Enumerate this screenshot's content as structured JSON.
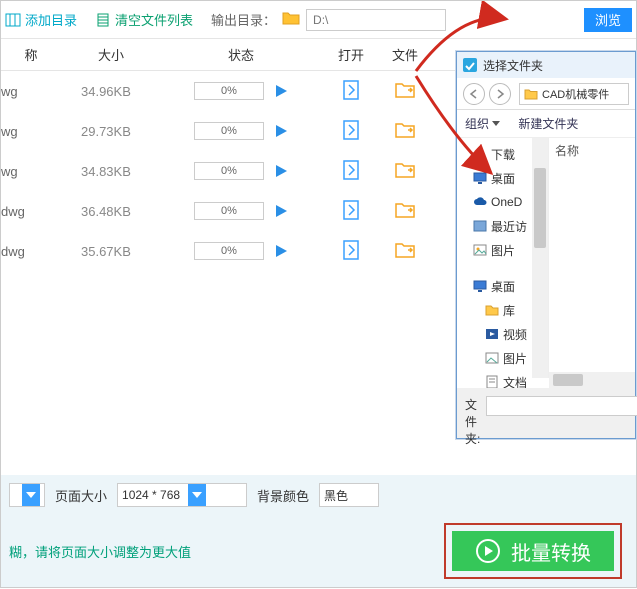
{
  "toolbar": {
    "add_dir": "添加目录",
    "clear_list": "清空文件列表",
    "output_label": "输出目录：",
    "path_placeholder": "D:\\",
    "browse": "浏览"
  },
  "headers": {
    "name": "称",
    "size": "大小",
    "status": "状态",
    "open": "打开",
    "file": "文件"
  },
  "rows": [
    {
      "name": "wg",
      "size": "34.96KB",
      "progress": "0%"
    },
    {
      "name": "wg",
      "size": "29.73KB",
      "progress": "0%"
    },
    {
      "name": "wg",
      "size": "34.83KB",
      "progress": "0%"
    },
    {
      "name": "dwg",
      "size": "36.48KB",
      "progress": "0%"
    },
    {
      "name": "dwg",
      "size": "35.67KB",
      "progress": "0%"
    }
  ],
  "bottom": {
    "page_size_label": "页面大小",
    "page_size_value": "1024 * 768",
    "bg_label": "背景颜色",
    "bg_value": "黑色"
  },
  "hint": "糊，请将页面大小调整为更大值",
  "convert_label": "批量转换",
  "popup": {
    "title": "选择文件夹",
    "addr": "CAD机械零件",
    "organize": "组织",
    "new_folder": "新建文件夹",
    "list_header": "名称",
    "footer_label": "文件夹:",
    "tree": [
      {
        "label": "下载",
        "icon": "download"
      },
      {
        "label": "桌面",
        "icon": "desktop"
      },
      {
        "label": "OneD",
        "icon": "cloud"
      },
      {
        "label": "最近访",
        "icon": "recent"
      },
      {
        "label": "图片",
        "icon": "image"
      },
      {
        "label": "桌面",
        "icon": "desktop2"
      },
      {
        "label": "库",
        "icon": "lib"
      },
      {
        "label": "视频",
        "icon": "video"
      },
      {
        "label": "图片",
        "icon": "image2"
      },
      {
        "label": "文档",
        "icon": "doc"
      }
    ]
  }
}
